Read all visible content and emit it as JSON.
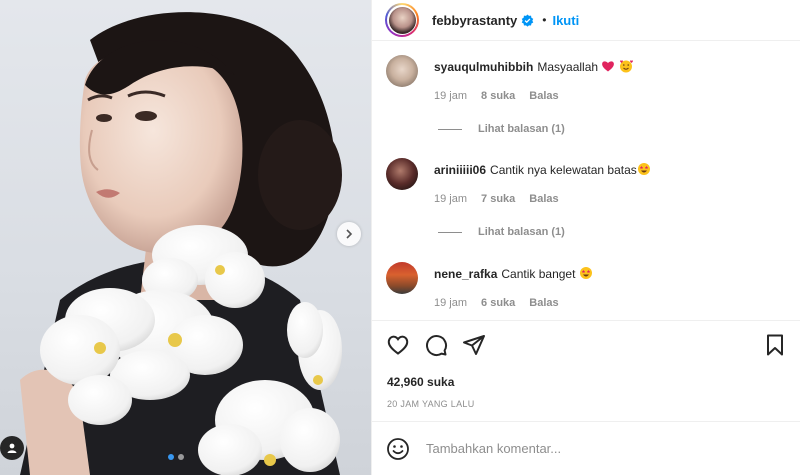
{
  "post": {
    "author": "febbyrastanty",
    "separator": "•",
    "follow_label": "Ikuti",
    "verified_icon": "verified-badge-icon",
    "accent_color": "#0095f6"
  },
  "media": {
    "slide_count": 2,
    "current_slide": 1,
    "next_icon": "chevron-right-icon",
    "tag_icon": "user-tag-icon"
  },
  "comments": [
    {
      "username": "syauqulmuhibbih",
      "text": "Masyaallah",
      "emojis": [
        "red-heart-emoji",
        "smiling-face-with-hearts-emoji"
      ],
      "time": "19 jam",
      "likes": "8 suka",
      "reply_label": "Balas",
      "view_replies": "Lihat balasan (1)"
    },
    {
      "username": "ariniiiii06",
      "text": "Cantik nya kelewatan batas",
      "emojis": [
        "star-struck-emoji"
      ],
      "time": "19 jam",
      "likes": "7 suka",
      "reply_label": "Balas",
      "view_replies": "Lihat balasan (1)"
    },
    {
      "username": "nene_rafka",
      "text": "Cantik banget",
      "emojis": [
        "star-struck-emoji"
      ],
      "time": "19 jam",
      "likes": "6 suka",
      "reply_label": "Balas"
    }
  ],
  "actions": {
    "icons": [
      "heart-icon",
      "comment-icon",
      "share-icon",
      "bookmark-icon"
    ]
  },
  "likes_label": "42,960 suka",
  "time_ago": "20 JAM YANG LALU",
  "add_comment": {
    "placeholder": "Tambahkan komentar...",
    "emoji_icon": "smiley-icon"
  }
}
